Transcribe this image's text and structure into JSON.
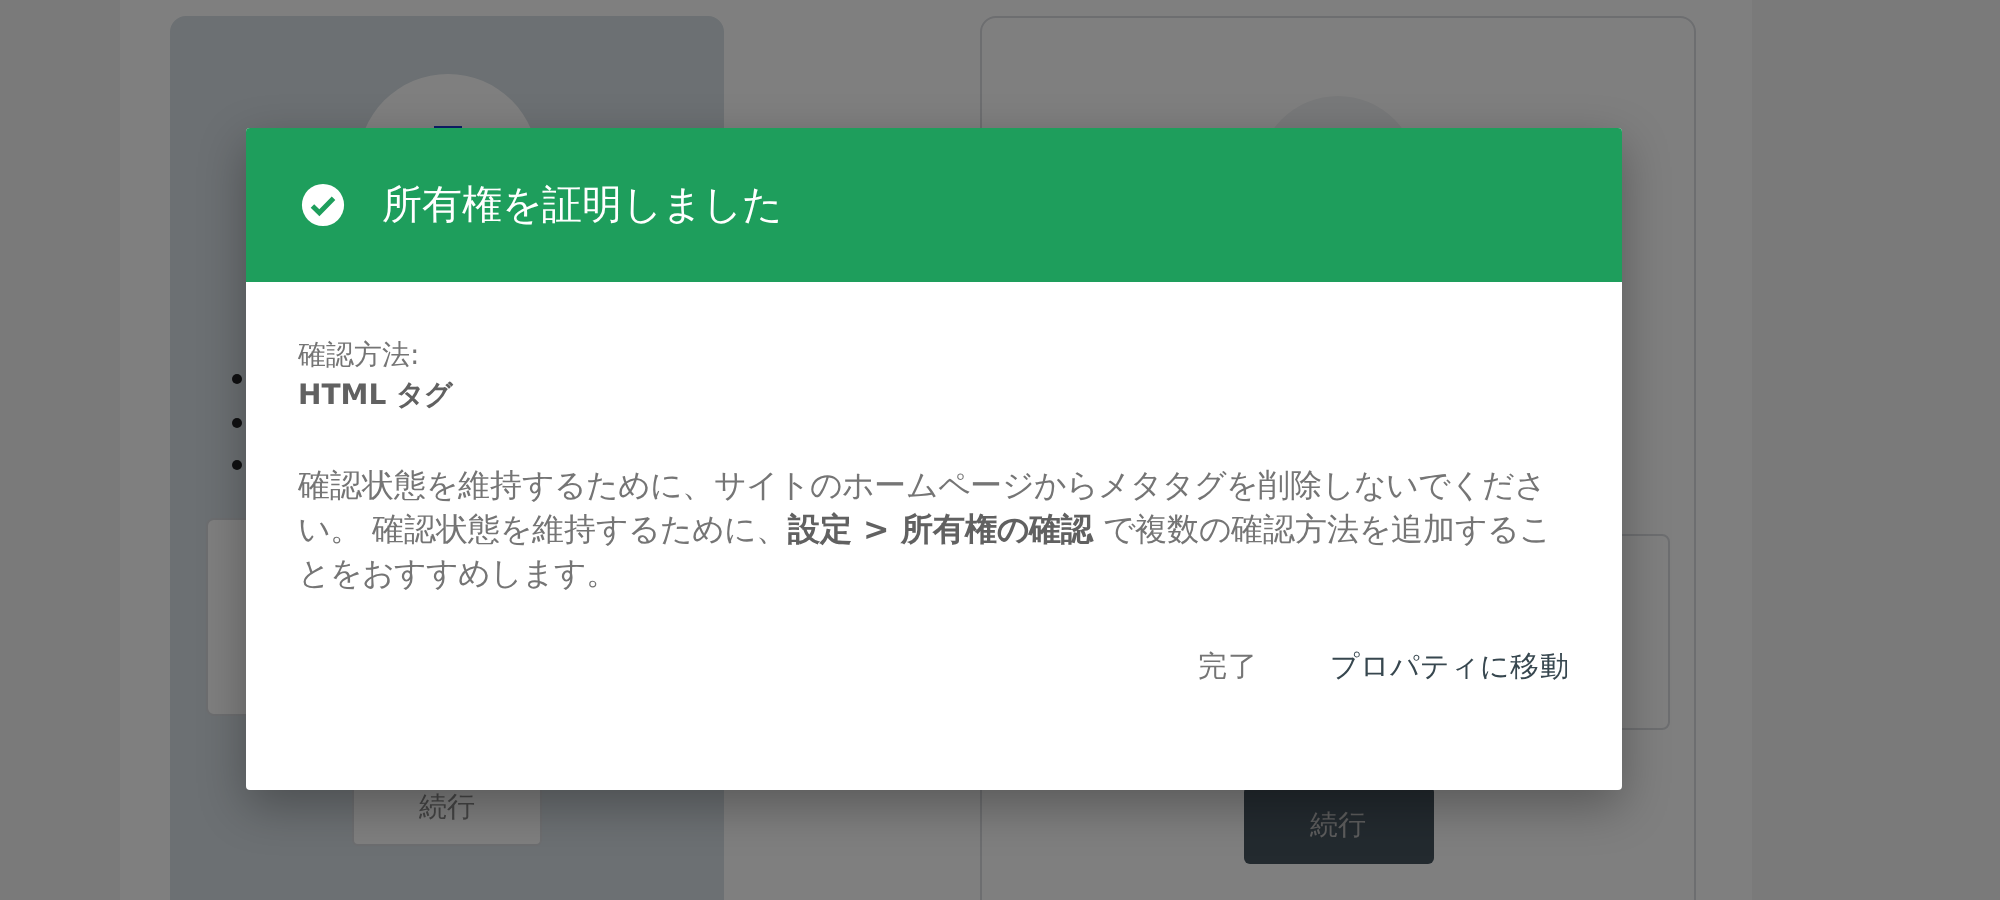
{
  "background": {
    "cards": [
      {
        "selected": true,
        "continue_button": "続行"
      },
      {
        "selected": false,
        "continue_button": "続行"
      }
    ]
  },
  "dialog": {
    "title": "所有権を証明しました",
    "method_label": "確認方法:",
    "method_value": "HTML タグ",
    "message": "確認状態を維持するために、サイトのホームページからメタタグを削除しないでください。 確認状態を維持するために、**設定 > 所有権の確認** で複数の確認方法を追加することをおすすめします。",
    "buttons": [
      {
        "label": "完了",
        "kind": "secondary"
      },
      {
        "label": "プロパティに移動",
        "kind": "primary"
      }
    ]
  }
}
